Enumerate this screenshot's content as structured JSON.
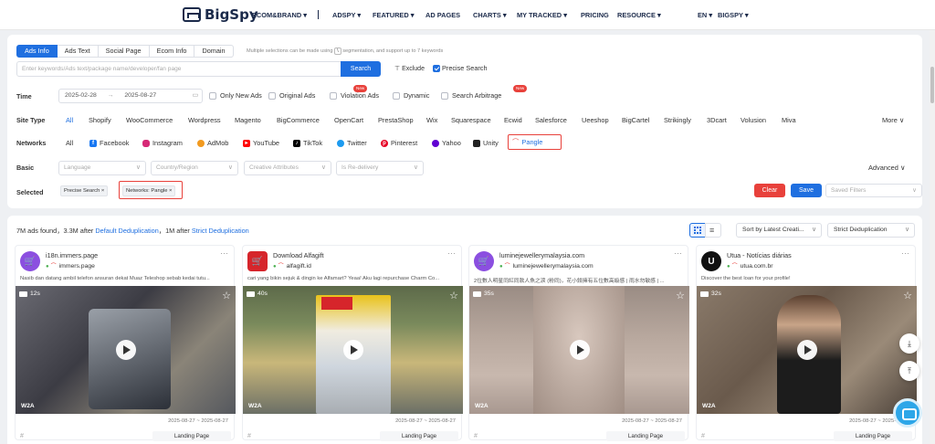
{
  "nav": {
    "logo": "BigSpy",
    "ecom_brand": "ECOM&BRAND ▾",
    "adspy": "ADSPY ▾",
    "featured": "FEATURED ▾",
    "ad_pages": "AD PAGES",
    "charts": "CHARTS ▾",
    "my_tracked": "MY TRACKED ▾",
    "pricing": "PRICING",
    "resource": "RESOURCE ▾",
    "lang": "EN ▾",
    "bigspy": "BIGSPY ▾"
  },
  "search": {
    "tabs": [
      "Ads Info",
      "Ads Text",
      "Social Page",
      "Ecom Info",
      "Domain"
    ],
    "hint": "Multiple selections can be made using",
    "hint2": "segmentation, and support up to 7 keywords",
    "placeholder": "Enter keywords/Ads text/package name/developer/fan page",
    "button": "Search",
    "exclude": "Exclude",
    "precise": "Precise Search"
  },
  "time": {
    "label": "Time",
    "start": "2025-02-28",
    "end": "2025-08-27",
    "options": [
      "Only New Ads",
      "Original Ads",
      "Violation Ads",
      "Dynamic",
      "Search Arbitrage"
    ],
    "new_badge": "New"
  },
  "site_type": {
    "label": "Site Type",
    "items": [
      "All",
      "Shopify",
      "WooCommerce",
      "Wordpress",
      "Magento",
      "BigCommerce",
      "OpenCart",
      "PrestaShop",
      "Wix",
      "Squarespace",
      "Ecwid",
      "Salesforce",
      "Ueeshop",
      "BigCartel",
      "Strikingly",
      "3Dcart",
      "Volusion",
      "Miva"
    ],
    "more": "More"
  },
  "networks": {
    "label": "Networks",
    "items": [
      "All",
      "Facebook",
      "Instagram",
      "AdMob",
      "YouTube",
      "TikTok",
      "Twitter",
      "Pinterest",
      "Yahoo",
      "Unity",
      "Pangle"
    ]
  },
  "basic": {
    "label": "Basic",
    "language": "Language",
    "country": "Country/Region",
    "creative": "Creative Attributes",
    "redelivery": "Is Re-delivery",
    "advanced": "Advanced"
  },
  "selected": {
    "label": "Selected",
    "chips": [
      "Precise Search ×",
      "Networks: Pangle ×"
    ],
    "clear": "Clear",
    "save": "Save",
    "saved_filters": "Saved Filters"
  },
  "results": {
    "count": "7M ads found，3.3M after",
    "default_dedup": "Default Deduplication",
    "mid": "，1M after",
    "strict_dedup": "Strict Deduplication",
    "sort": "Sort by Latest Creati...",
    "dedup_select": "Strict Deduplication"
  },
  "cards": [
    {
      "title": "i18n.immers.page",
      "domain": "immers.page",
      "desc": "Nasib dan datang ambil telefon ansuran dekat Muaz Teleshop sebab kedai tutu...",
      "duration": "12s",
      "date": "2025-08-27 ~ 2025-08-27",
      "badge": "W2A",
      "landing": "Landing Page",
      "avatar_color": "#8b4fe0"
    },
    {
      "title": "Download Alfagift",
      "domain": "alfagift.id",
      "desc": "cari yang bikin sejuk & dingin ke Alfamart? Yeaa! Aku lagi repurchase Charm Co...",
      "duration": "40s",
      "date": "2025-08-27 ~ 2025-08-27",
      "badge": "W2A",
      "landing": "Landing Page",
      "avatar_color": "#d6252b"
    },
    {
      "title": "luminejewellerymalaysia.com",
      "domain": "luminejewellerymalaysia.com",
      "desc": "2位數人明星同紅同款人魚之淚 (粉同)，花小錢擁有五位數高級感 | 雨水勿敏感 | ...",
      "duration": "35s",
      "date": "2025-08-27 ~ 2025-08-27",
      "badge": "W2A",
      "landing": "Landing Page",
      "avatar_color": "#8b4fe0"
    },
    {
      "title": "Utua - Notícias diárias",
      "domain": "utua.com.br",
      "desc": "Discover the best loan for your profile!",
      "duration": "32s",
      "date": "2025-08-27 ~ 2025-08-27",
      "badge": "W2A",
      "landing": "Landing Page",
      "avatar_color": "#111111"
    }
  ]
}
